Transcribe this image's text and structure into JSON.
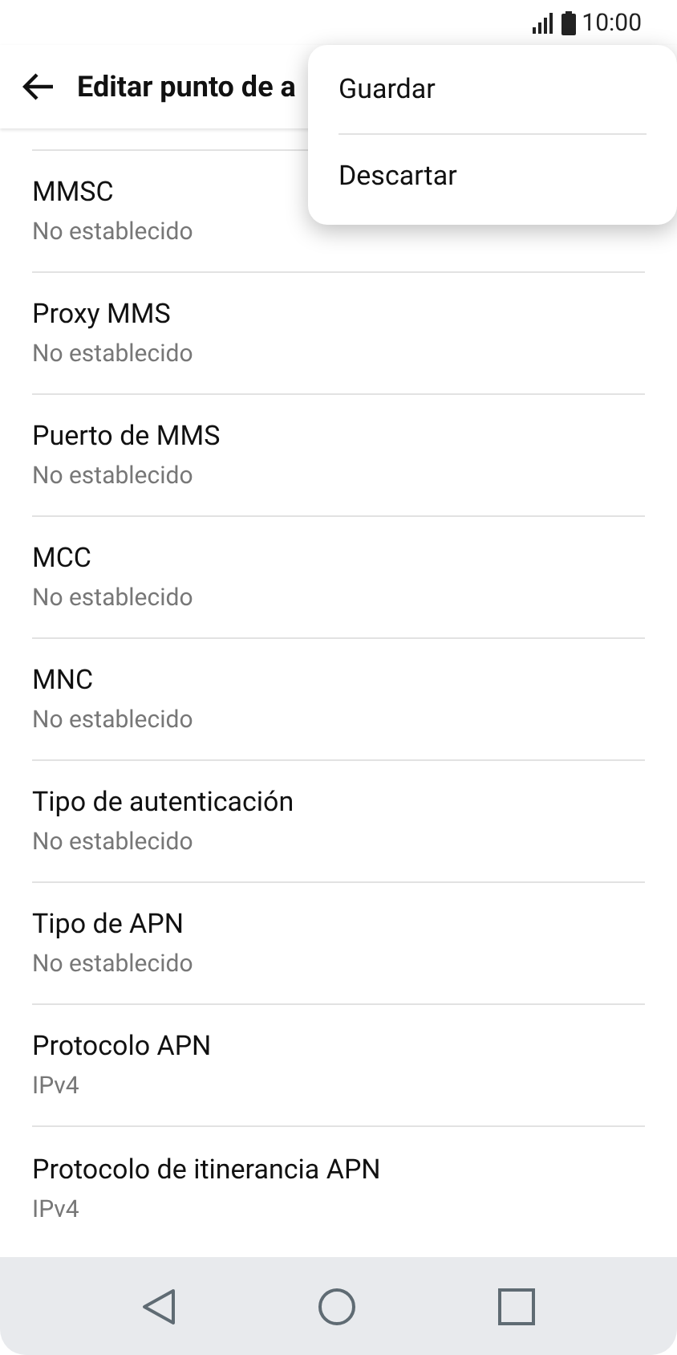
{
  "status_bar": {
    "time": "10:00"
  },
  "app_bar": {
    "title": "Editar punto de a"
  },
  "menu": {
    "items": [
      {
        "label": "Guardar"
      },
      {
        "label": "Descartar"
      }
    ]
  },
  "settings": [
    {
      "title": "MMSC",
      "value": "No establecido"
    },
    {
      "title": "Proxy MMS",
      "value": "No establecido"
    },
    {
      "title": "Puerto de MMS",
      "value": "No establecido"
    },
    {
      "title": "MCC",
      "value": "No establecido"
    },
    {
      "title": "MNC",
      "value": "No establecido"
    },
    {
      "title": "Tipo de autenticación",
      "value": "No establecido"
    },
    {
      "title": "Tipo de APN",
      "value": "No establecido"
    },
    {
      "title": "Protocolo APN",
      "value": "IPv4"
    },
    {
      "title": "Protocolo de itinerancia APN",
      "value": "IPv4"
    }
  ]
}
